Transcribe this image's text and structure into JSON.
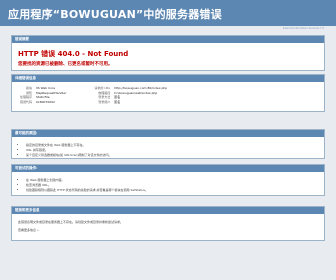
{
  "window": {
    "title": "应用程序“BOWUGUAN”中的服务器错误"
  },
  "server_info": "Internet Information Services 7.5",
  "error_panel": {
    "header": "错误摘要",
    "http_error": "HTTP 错误 404.0 - Not Found",
    "description": "您要找的资源已被删除、已更名或暂时不可用。"
  },
  "detail_panel": {
    "header": "详细错误信息",
    "left": [
      {
        "k": "模块",
        "v": "IIS Web Core"
      },
      {
        "k": "通知",
        "v": "MapRequestHandler"
      },
      {
        "k": "处理程序",
        "v": "StaticFile"
      },
      {
        "k": "错误代码",
        "v": "0x80070002"
      }
    ],
    "right": [
      {
        "k": "请求的 URL",
        "v": "http://bowuguan.com:80/index.php"
      },
      {
        "k": "物理路径",
        "v": "D:\\bowuguan\\web\\index.php"
      },
      {
        "k": "登录方法",
        "v": "匿名"
      },
      {
        "k": "登录用户",
        "v": "匿名"
      }
    ]
  },
  "reason_panel": {
    "header": "最可能的原因:",
    "items": [
      "指定的目录或文件在 Web 服务器上不存在。",
      "URL 拼写错误。",
      "某个自定义筛选器或模块(如 URLScan)限制了对该文件的访问。"
    ]
  },
  "solve_panel": {
    "header": "可尝试的操作:",
    "items": [
      "在 Web 服务器上创建内容。",
      "检查浏览器 URL。",
      "创建跟踪规则以跟踪此 HTTP 状态代码的失败的请求,并查看是哪个模块在调用 SetStatus。"
    ]
  },
  "info_panel": {
    "header": "链接和更多信息",
    "lines": [
      "此错误表明文件或目录在服务器上不存在。请创建文件或目录并重新尝试请求。",
      "查看更多信息 »"
    ]
  }
}
